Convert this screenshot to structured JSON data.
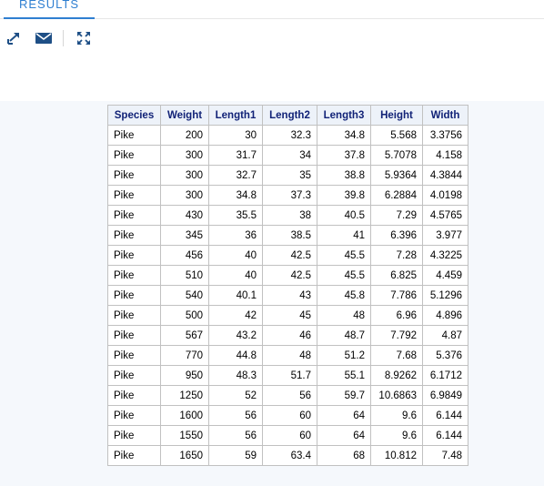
{
  "tab": {
    "label": "RESULTS"
  },
  "toolbar": {
    "icons": [
      "open-in-new-window-icon",
      "email-icon",
      "expand-icon"
    ]
  },
  "table": {
    "columns": [
      "Species",
      "Weight",
      "Length1",
      "Length2",
      "Length3",
      "Height",
      "Width"
    ],
    "rows": [
      [
        "Pike",
        "200",
        "30",
        "32.3",
        "34.8",
        "5.568",
        "3.3756"
      ],
      [
        "Pike",
        "300",
        "31.7",
        "34",
        "37.8",
        "5.7078",
        "4.158"
      ],
      [
        "Pike",
        "300",
        "32.7",
        "35",
        "38.8",
        "5.9364",
        "4.3844"
      ],
      [
        "Pike",
        "300",
        "34.8",
        "37.3",
        "39.8",
        "6.2884",
        "4.0198"
      ],
      [
        "Pike",
        "430",
        "35.5",
        "38",
        "40.5",
        "7.29",
        "4.5765"
      ],
      [
        "Pike",
        "345",
        "36",
        "38.5",
        "41",
        "6.396",
        "3.977"
      ],
      [
        "Pike",
        "456",
        "40",
        "42.5",
        "45.5",
        "7.28",
        "4.3225"
      ],
      [
        "Pike",
        "510",
        "40",
        "42.5",
        "45.5",
        "6.825",
        "4.459"
      ],
      [
        "Pike",
        "540",
        "40.1",
        "43",
        "45.8",
        "7.786",
        "5.1296"
      ],
      [
        "Pike",
        "500",
        "42",
        "45",
        "48",
        "6.96",
        "4.896"
      ],
      [
        "Pike",
        "567",
        "43.2",
        "46",
        "48.7",
        "7.792",
        "4.87"
      ],
      [
        "Pike",
        "770",
        "44.8",
        "48",
        "51.2",
        "7.68",
        "5.376"
      ],
      [
        "Pike",
        "950",
        "48.3",
        "51.7",
        "55.1",
        "8.9262",
        "6.1712"
      ],
      [
        "Pike",
        "1250",
        "52",
        "56",
        "59.7",
        "10.6863",
        "6.9849"
      ],
      [
        "Pike",
        "1600",
        "56",
        "60",
        "64",
        "9.6",
        "6.144"
      ],
      [
        "Pike",
        "1550",
        "56",
        "60",
        "64",
        "9.6",
        "6.144"
      ],
      [
        "Pike",
        "1650",
        "59",
        "63.4",
        "68",
        "10.812",
        "7.48"
      ]
    ]
  },
  "colors": {
    "accent": "#2f7fd1",
    "header_text": "#112277",
    "header_bg": "#edf2f9",
    "icon": "#1e4f86"
  }
}
